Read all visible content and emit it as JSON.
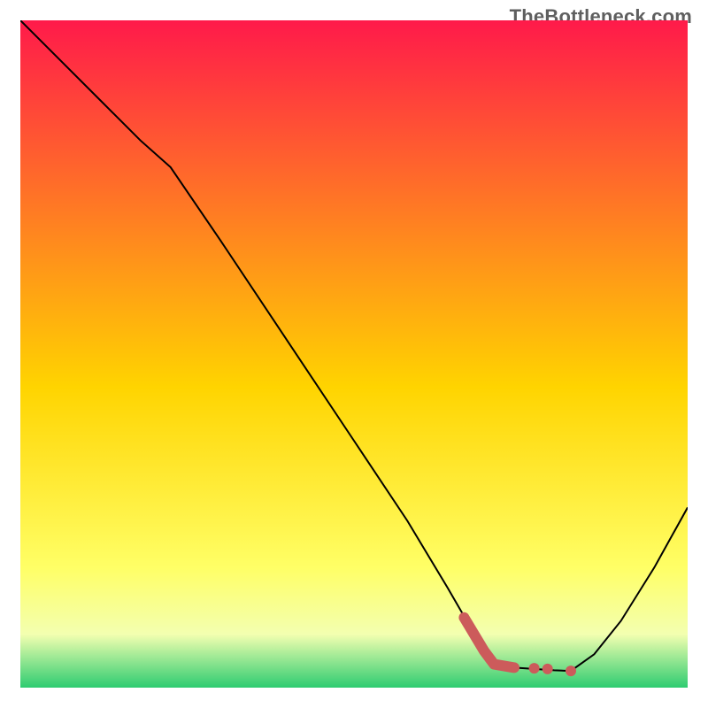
{
  "watermark": "TheBottleneck.com",
  "chart_data": {
    "type": "line",
    "title": "",
    "xlabel": "",
    "ylabel": "",
    "xlim": [
      0,
      1
    ],
    "ylim": [
      0,
      1
    ],
    "gradient_stops": [
      {
        "offset": 0,
        "color": "#ff1a4a"
      },
      {
        "offset": 0.55,
        "color": "#ffd400"
      },
      {
        "offset": 0.82,
        "color": "#ffff66"
      },
      {
        "offset": 0.92,
        "color": "#f3ffb0"
      },
      {
        "offset": 1,
        "color": "#2ecc71"
      }
    ],
    "series": [
      {
        "name": "curve",
        "stroke": "#000000",
        "stroke_width": 2,
        "points": [
          {
            "x": 0.0,
            "y": 1.0
          },
          {
            "x": 0.06,
            "y": 0.94
          },
          {
            "x": 0.12,
            "y": 0.88
          },
          {
            "x": 0.18,
            "y": 0.82
          },
          {
            "x": 0.225,
            "y": 0.78
          },
          {
            "x": 0.3,
            "y": 0.67
          },
          {
            "x": 0.4,
            "y": 0.52
          },
          {
            "x": 0.5,
            "y": 0.37
          },
          {
            "x": 0.58,
            "y": 0.25
          },
          {
            "x": 0.64,
            "y": 0.15
          },
          {
            "x": 0.695,
            "y": 0.055
          },
          {
            "x": 0.71,
            "y": 0.035
          },
          {
            "x": 0.74,
            "y": 0.03
          },
          {
            "x": 0.8,
            "y": 0.026
          },
          {
            "x": 0.825,
            "y": 0.025
          },
          {
            "x": 0.86,
            "y": 0.05
          },
          {
            "x": 0.9,
            "y": 0.1
          },
          {
            "x": 0.95,
            "y": 0.18
          },
          {
            "x": 1.0,
            "y": 0.27
          }
        ]
      },
      {
        "name": "highlight",
        "stroke": "#cc5b5b",
        "stroke_width": 12,
        "linecap": "round",
        "points": [
          {
            "x": 0.665,
            "y": 0.105
          },
          {
            "x": 0.695,
            "y": 0.055
          },
          {
            "x": 0.71,
            "y": 0.035
          },
          {
            "x": 0.74,
            "y": 0.03
          }
        ]
      }
    ],
    "highlight_dots": {
      "stroke": "#cc5b5b",
      "radius": 6,
      "points": [
        {
          "x": 0.77,
          "y": 0.029
        },
        {
          "x": 0.79,
          "y": 0.028
        },
        {
          "x": 0.825,
          "y": 0.025
        }
      ]
    }
  }
}
